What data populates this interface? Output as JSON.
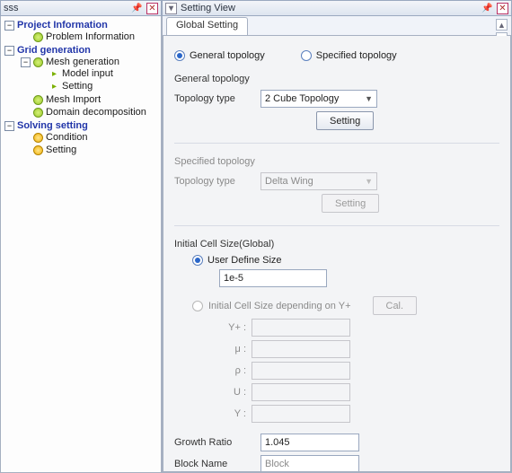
{
  "left": {
    "title": "sss",
    "tree": {
      "project_info": "Project Information",
      "problem_info": "Problem Information",
      "grid_gen": "Grid generation",
      "mesh_gen": "Mesh generation",
      "model_input": "Model input",
      "setting": "Setting",
      "mesh_import": "Mesh Import",
      "domain_decomp": "Domain decomposition",
      "solving": "Solving setting",
      "condition": "Condition",
      "solve_setting": "Setting"
    }
  },
  "right": {
    "title": "Setting View",
    "tab": "Global Setting",
    "radios": {
      "general": "General topology",
      "specified": "Specified topology"
    },
    "general": {
      "group": "General topology",
      "type_label": "Topology type",
      "type_value": "2 Cube Topology",
      "setting_btn": "Setting"
    },
    "specified": {
      "group": "Specified topology",
      "type_label": "Topology type",
      "type_value": "Delta Wing",
      "setting_btn": "Setting"
    },
    "initcell": {
      "group": "Initial Cell Size(Global)",
      "user_define": "User Define Size",
      "user_define_value": "1e-5",
      "yplus_opt": "Initial Cell Size depending on Y+",
      "cal_btn": "Cal.",
      "yplus": "Y+ :",
      "mu": "μ :",
      "rho": "ρ :",
      "u": "U :",
      "y": "Y :"
    },
    "growth": {
      "label": "Growth Ratio",
      "value": "1.045"
    },
    "block": {
      "label": "Block Name",
      "value": "Block"
    }
  }
}
